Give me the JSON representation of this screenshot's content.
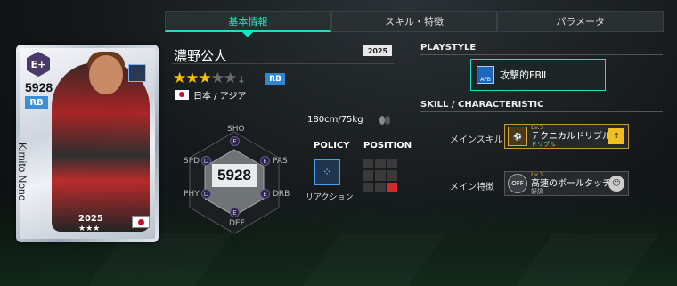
{
  "tabs": [
    {
      "label": "基本情報",
      "active": true
    },
    {
      "label": "スキル・特徴",
      "active": false
    },
    {
      "label": "パラメータ",
      "active": false
    }
  ],
  "card": {
    "rank_badge": "E+",
    "ovr": "5928",
    "position": "RB",
    "name": "Kimito Nono",
    "year": "2025",
    "stars": "★★★"
  },
  "player": {
    "name": "濃野公人",
    "year": "2025",
    "stars_on": 3,
    "stars_total": 5,
    "star_plus_glyph": "‡",
    "position": "RB",
    "nationality": "日本 / アジア",
    "height_weight": "180cm/75kg"
  },
  "stats": {
    "ovr": "5928",
    "labels": {
      "sho": "SHO",
      "pas": "PAS",
      "drb": "DRB",
      "def": "DEF",
      "phy": "PHY",
      "spd": "SPD"
    },
    "ranks": {
      "sho": "E",
      "pas": "E",
      "drb": "E",
      "def": "E",
      "phy": "D",
      "spd": "D"
    }
  },
  "policy": {
    "header": "POLICY",
    "label": "リアクション"
  },
  "position_section": {
    "header": "POSITION"
  },
  "playstyle": {
    "header": "PLAYSTYLE",
    "icon_text": "AFB",
    "name": "攻撃的FBⅡ"
  },
  "skill": {
    "header": "SKILL / CHARACTERISTIC",
    "main_skill_label": "メインスキル",
    "main_skill": {
      "level": "Lv.3",
      "name": "テクニカルドリブル",
      "sub": "ドリブル"
    },
    "main_trait_label": "メイン特徴",
    "main_trait": {
      "level": "Lv.3",
      "name": "高速のボールタッチ",
      "sub": "好調",
      "icon_text": "OFF"
    }
  },
  "colors": {
    "accent": "#19e3c5",
    "star": "#f5c000",
    "position_blue": "#2f86d1"
  }
}
